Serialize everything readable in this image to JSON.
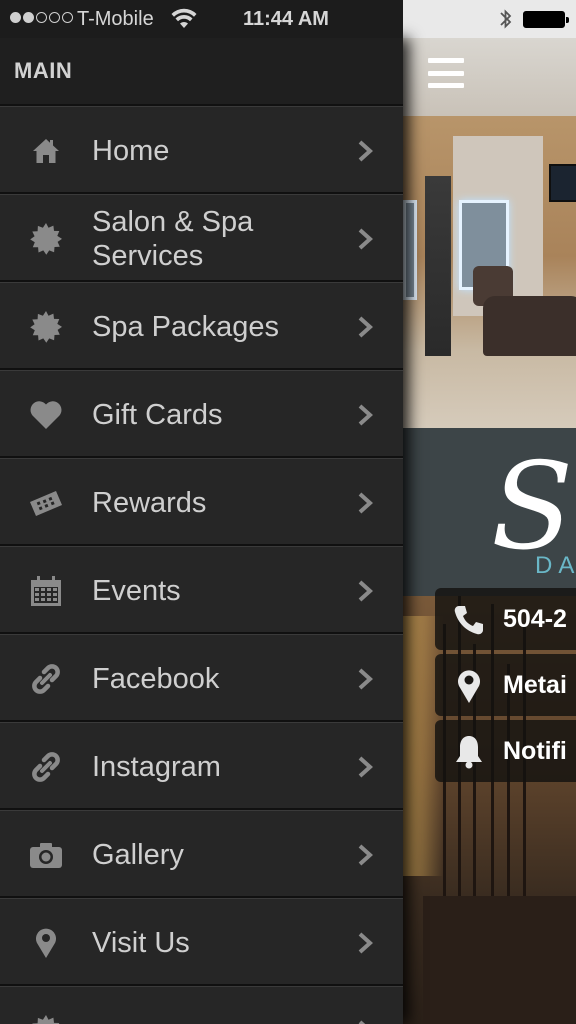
{
  "status_bar": {
    "carrier": "T-Mobile",
    "time": "11:44 AM",
    "signal_bars": 2,
    "signal_total": 5
  },
  "menu": {
    "header": "MAIN",
    "items": [
      {
        "label": "Home",
        "icon": "home-icon"
      },
      {
        "label": "Salon & Spa Services",
        "icon": "badge-icon"
      },
      {
        "label": "Spa Packages",
        "icon": "badge-icon"
      },
      {
        "label": "Gift Cards",
        "icon": "heart-icon"
      },
      {
        "label": "Rewards",
        "icon": "ticket-icon"
      },
      {
        "label": "Events",
        "icon": "calendar-icon"
      },
      {
        "label": "Facebook",
        "icon": "link-icon"
      },
      {
        "label": "Instagram",
        "icon": "link-icon"
      },
      {
        "label": "Gallery",
        "icon": "camera-icon"
      },
      {
        "label": "Visit Us",
        "icon": "map-pin-icon"
      },
      {
        "label": "",
        "icon": "badge-icon"
      }
    ]
  },
  "app_behind": {
    "logo_letter": "S",
    "logo_sub": "DA",
    "contacts": [
      {
        "text": "504-2",
        "icon": "phone-icon"
      },
      {
        "text": "Metai",
        "icon": "map-pin-icon"
      },
      {
        "text": "Notifi",
        "icon": "bell-icon"
      }
    ]
  },
  "colors": {
    "menu_bg": "#262626",
    "menu_text": "#cfcfcf",
    "icon_gray": "#8a8a8a",
    "logo_band": "#3d4548",
    "logo_accent": "#6ab7c7"
  }
}
